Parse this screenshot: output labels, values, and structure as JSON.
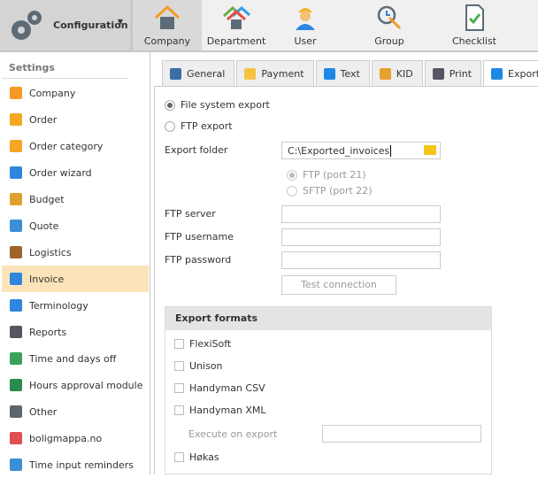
{
  "header": {
    "title": "Configuration",
    "tabs": [
      {
        "label": "Company",
        "selected": true
      },
      {
        "label": "Department"
      },
      {
        "label": "User"
      },
      {
        "label": "Group"
      },
      {
        "label": "Checklist"
      }
    ]
  },
  "sidebar": {
    "heading": "Settings",
    "items": [
      {
        "label": "Company",
        "icon": "house-icon",
        "color": "#f59a23"
      },
      {
        "label": "Order",
        "icon": "clipboard-icon",
        "color": "#f5a623"
      },
      {
        "label": "Order category",
        "icon": "clipboard-icon",
        "color": "#f5a623"
      },
      {
        "label": "Order wizard",
        "icon": "wizard-icon",
        "color": "#2e86de"
      },
      {
        "label": "Budget",
        "icon": "scales-icon",
        "color": "#e0a030"
      },
      {
        "label": "Quote",
        "icon": "calculator-icon",
        "color": "#3a8fd6"
      },
      {
        "label": "Logistics",
        "icon": "box-icon",
        "color": "#a0622d"
      },
      {
        "label": "Invoice",
        "icon": "invoice-icon",
        "color": "#2e86de",
        "selected": true
      },
      {
        "label": "Terminology",
        "icon": "terminology-icon",
        "color": "#2e86de"
      },
      {
        "label": "Reports",
        "icon": "printer-icon",
        "color": "#556"
      },
      {
        "label": "Time and days off",
        "icon": "globe-icon",
        "color": "#3aa05a"
      },
      {
        "label": "Hours approval module",
        "icon": "clock-check-icon",
        "color": "#2d8a4e"
      },
      {
        "label": "Other",
        "icon": "gear-icon",
        "color": "#5a6772"
      },
      {
        "label": "boligmappa.no",
        "icon": "boligmappa-icon",
        "color": "#e05050"
      },
      {
        "label": "Time input reminders",
        "icon": "alarm-icon",
        "color": "#3a8fd6"
      }
    ]
  },
  "tabs": [
    {
      "label": "General",
      "icon": "document-icon",
      "color": "#3a6ea5"
    },
    {
      "label": "Payment",
      "icon": "payment-icon",
      "color": "#f5c242"
    },
    {
      "label": "Text",
      "icon": "info-icon",
      "color": "#1e88e5"
    },
    {
      "label": "KID",
      "icon": "kid-icon",
      "color": "#e8a030"
    },
    {
      "label": "Print",
      "icon": "printer-icon",
      "color": "#556"
    },
    {
      "label": "Export",
      "icon": "upload-icon",
      "color": "#1e88e5",
      "selected": true
    }
  ],
  "export": {
    "file_system_export": "File system export",
    "ftp_export": "FTP export",
    "selected_mode": "File system export",
    "export_folder_label": "Export folder",
    "export_folder_value": "C:\\Exported_invoices",
    "ftp_port21": "FTP (port 21)",
    "ftp_port22": "SFTP (port 22)",
    "ftp_server_label": "FTP server",
    "ftp_username_label": "FTP username",
    "ftp_password_label": "FTP password",
    "test_connection": "Test connection",
    "formats_heading": "Export formats",
    "formats": [
      {
        "label": "FlexiSoft",
        "checked": false
      },
      {
        "label": "Unison",
        "checked": false
      },
      {
        "label": "Handyman CSV",
        "checked": false
      },
      {
        "label": "Handyman XML",
        "checked": false
      },
      {
        "label": "Høkas",
        "checked": false
      }
    ],
    "execute_on_export_label": "Execute on export"
  }
}
